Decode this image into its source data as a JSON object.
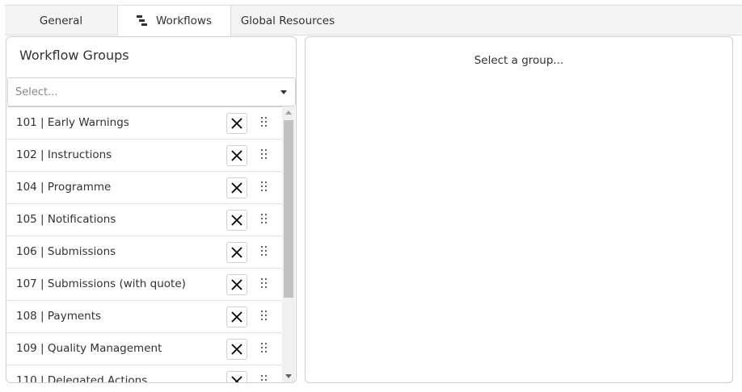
{
  "tabs": [
    {
      "label": "General"
    },
    {
      "label": "Workflows",
      "icon": "workflow-icon",
      "active": true
    },
    {
      "label": "Global Resources"
    }
  ],
  "workflow_groups": {
    "title": "Workflow Groups",
    "select": {
      "placeholder": "Select..."
    },
    "items": [
      {
        "label": "101 | Early Warnings"
      },
      {
        "label": "102 | Instructions"
      },
      {
        "label": "104 | Programme"
      },
      {
        "label": "105 | Notifications"
      },
      {
        "label": "106 | Submissions"
      },
      {
        "label": "107 | Submissions (with quote)"
      },
      {
        "label": "108 | Payments"
      },
      {
        "label": "109 | Quality Management"
      },
      {
        "label": "110 | Delegated Actions"
      }
    ]
  },
  "detail": {
    "placeholder": "Select a group..."
  },
  "colors": {
    "border": "#d0d0d0",
    "tabbar_bg": "#f4f4f4",
    "scroll_thumb": "#c1c1c1"
  }
}
